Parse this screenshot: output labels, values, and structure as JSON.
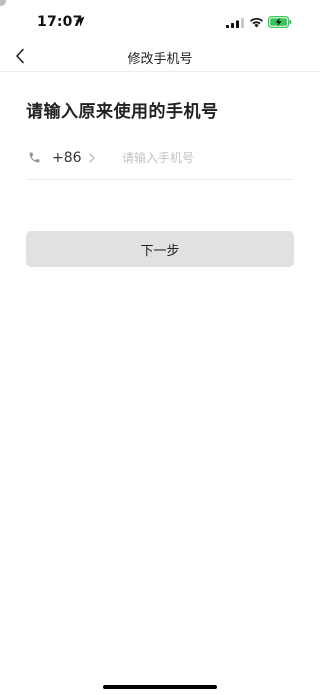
{
  "status_bar": {
    "time": "17:07",
    "icons": [
      "location-arrow-icon",
      "cellular-signal-icon",
      "wifi-icon",
      "battery-charging-icon"
    ],
    "battery_color": "#35c759"
  },
  "nav": {
    "title": "修改手机号",
    "back_icon": "chevron-left-icon"
  },
  "main": {
    "heading": "请输入原来使用的手机号",
    "phone_field": {
      "icon": "phone-icon",
      "country_code": "+86",
      "chevron_icon": "chevron-right-icon",
      "value": "",
      "placeholder": "请输入手机号"
    },
    "next_button": {
      "label": "下一步",
      "background": "#e1e1e1"
    }
  }
}
